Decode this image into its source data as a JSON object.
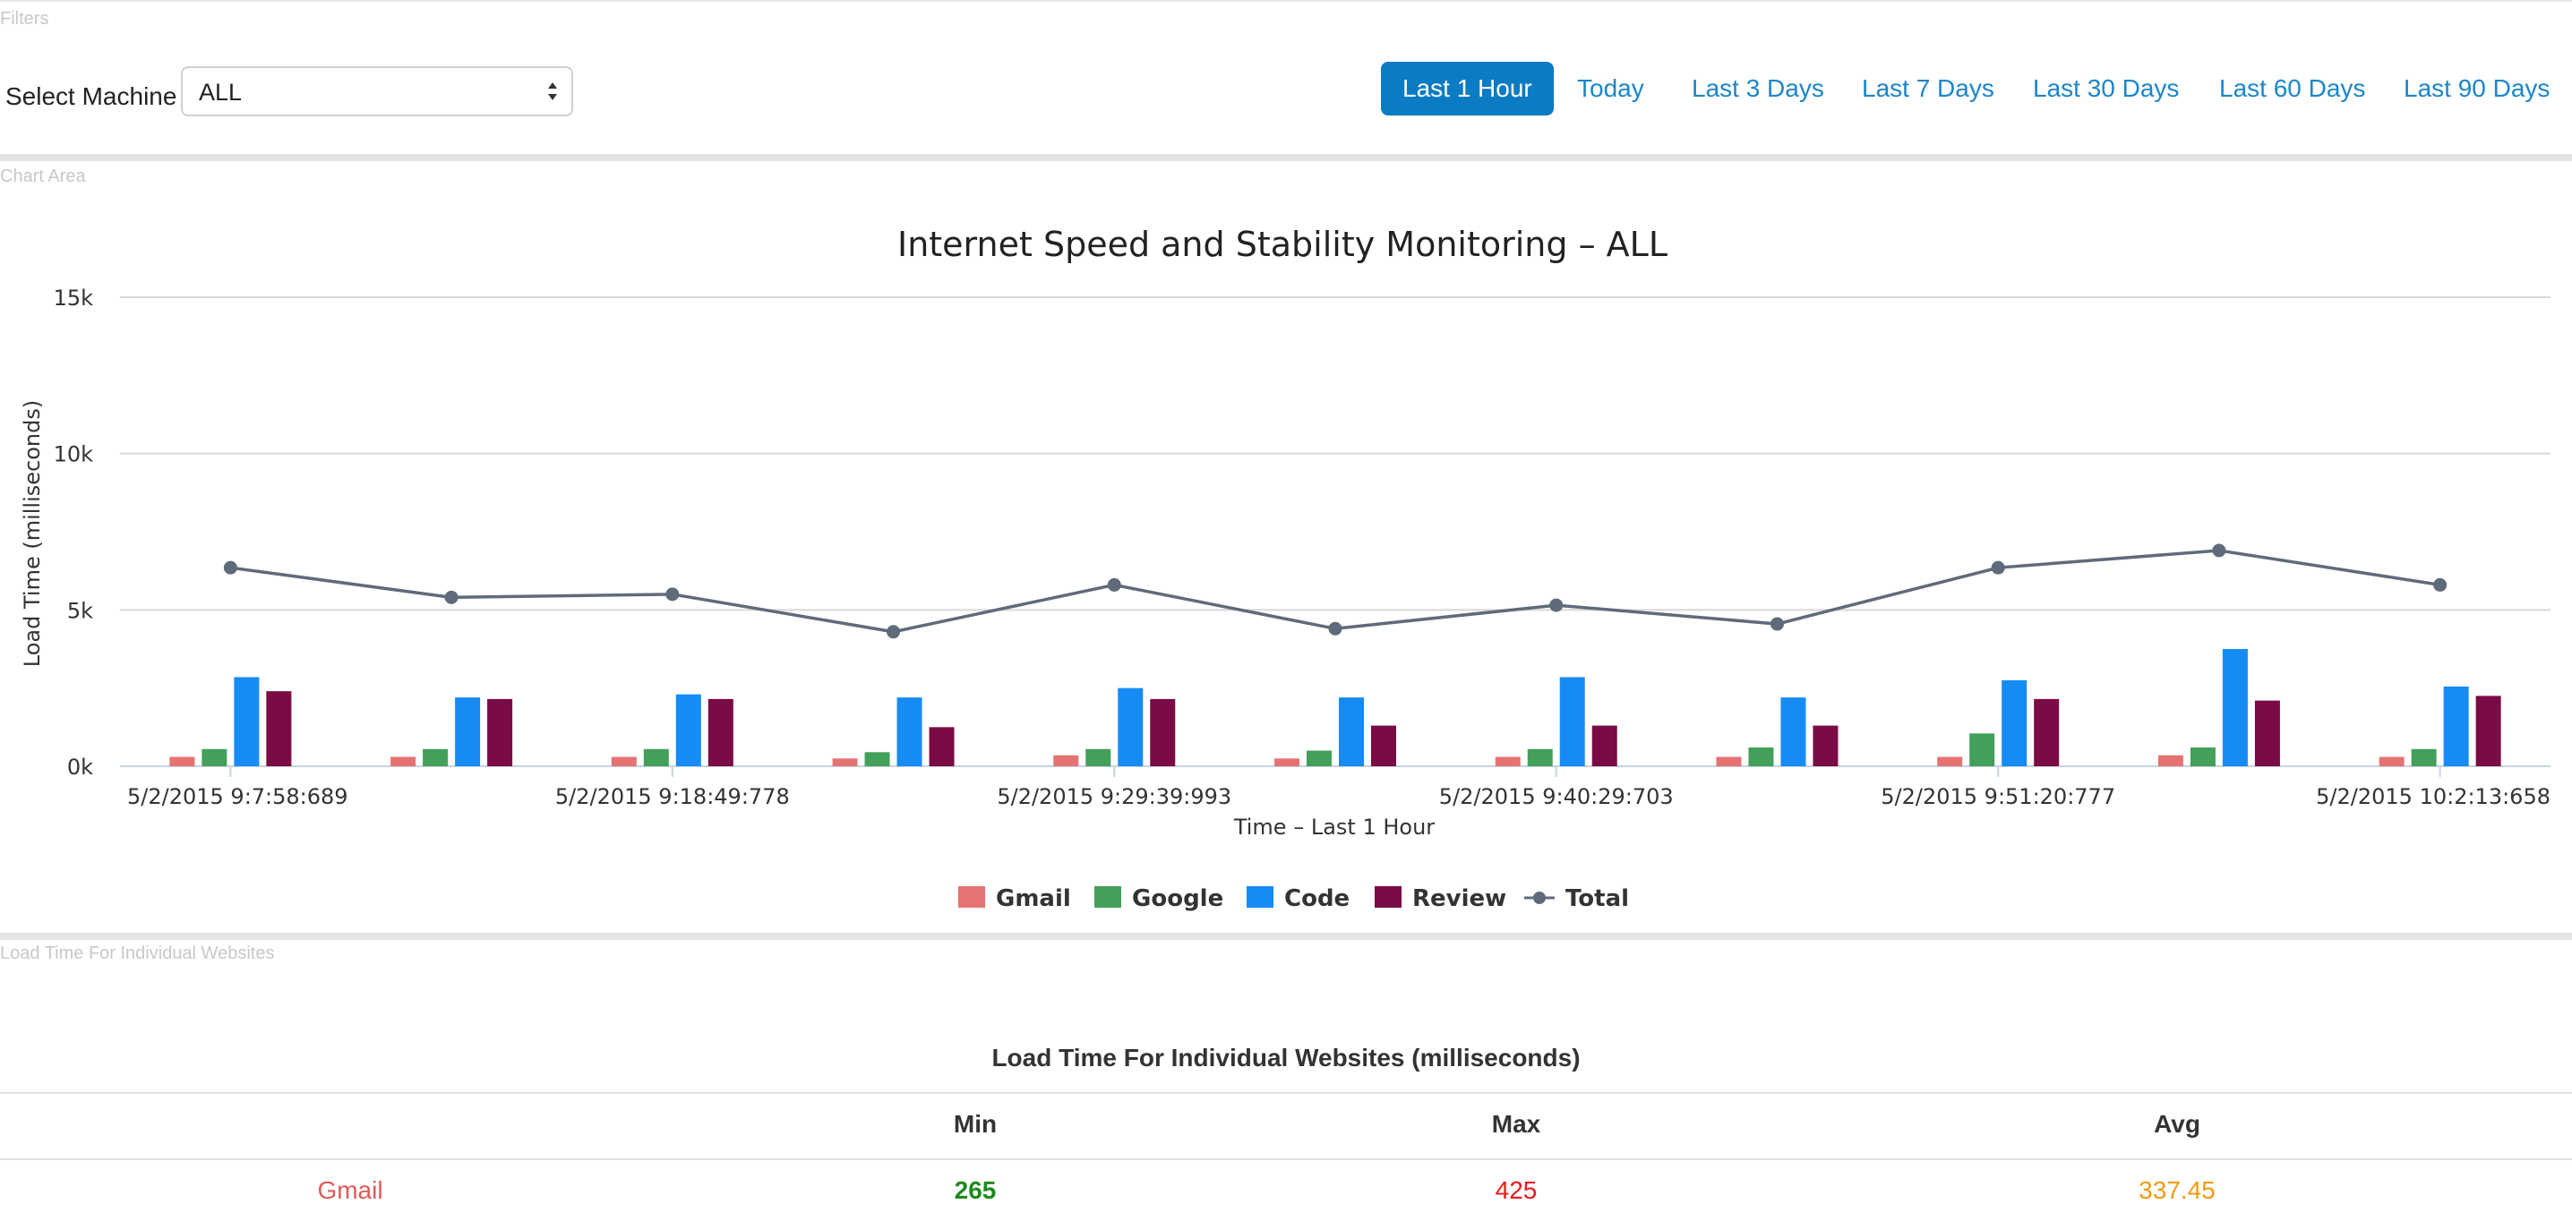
{
  "filters": {
    "section_label": "Filters",
    "machine_label": "Select Machine",
    "machine_value": "ALL",
    "ranges": [
      {
        "label": "Last 1 Hour",
        "active": true
      },
      {
        "label": "Today",
        "active": false
      },
      {
        "label": "Last 3 Days",
        "active": false
      },
      {
        "label": "Last 7 Days",
        "active": false
      },
      {
        "label": "Last 30 Days",
        "active": false
      },
      {
        "label": "Last 60 Days",
        "active": false
      },
      {
        "label": "Last 90 Days",
        "active": false
      }
    ]
  },
  "chart_section_label": "Chart Area",
  "chart_data": {
    "type": "bar",
    "title": "Internet Speed and Stability Monitoring – ALL",
    "xlabel": "Time – Last 1 Hour",
    "ylabel": "Load Time (milliseconds)",
    "ylim": [
      0,
      15000
    ],
    "yticks": [
      0,
      5000,
      10000,
      15000
    ],
    "ytick_labels": [
      "0k",
      "5k",
      "10k",
      "15k"
    ],
    "grid": true,
    "legend_position": "bottom",
    "x_tick_labels": [
      {
        "index": 0,
        "label": "5/2/2015 9:7:58:689"
      },
      {
        "index": 2,
        "label": "5/2/2015 9:18:49:778"
      },
      {
        "index": 4,
        "label": "5/2/2015 9:29:39:993"
      },
      {
        "index": 6,
        "label": "5/2/2015 9:40:29:703"
      },
      {
        "index": 8,
        "label": "5/2/2015 9:51:20:777"
      },
      {
        "index": 10,
        "label": "5/2/2015 10:2:13:658"
      }
    ],
    "category_count": 11,
    "series": [
      {
        "name": "Gmail",
        "kind": "bar",
        "color": "#e57373",
        "values": [
          300,
          300,
          300,
          250,
          350,
          250,
          300,
          300,
          300,
          350,
          300
        ]
      },
      {
        "name": "Google",
        "kind": "bar",
        "color": "#43a05a",
        "values": [
          550,
          550,
          550,
          450,
          550,
          500,
          550,
          600,
          1050,
          600,
          550
        ]
      },
      {
        "name": "Code",
        "kind": "bar",
        "color": "#168bf5",
        "values": [
          2850,
          2200,
          2300,
          2200,
          2500,
          2200,
          2850,
          2200,
          2750,
          3750,
          2550
        ]
      },
      {
        "name": "Review",
        "kind": "bar",
        "color": "#7a0b44",
        "values": [
          2400,
          2150,
          2150,
          1250,
          2150,
          1300,
          1300,
          1300,
          2150,
          2100,
          2250
        ]
      },
      {
        "name": "Total",
        "kind": "line",
        "color": "#5f6b7a",
        "values": [
          6350,
          5400,
          5500,
          4300,
          5800,
          4400,
          5150,
          4550,
          6350,
          6900,
          5800
        ]
      }
    ]
  },
  "table": {
    "section_label": "Load Time For Individual Websites",
    "title": "Load Time For Individual Websites (milliseconds)",
    "headers": [
      "",
      "Min",
      "Max",
      "Avg"
    ],
    "rows": [
      {
        "name": "Gmail",
        "min": "265",
        "max": "425",
        "avg": "337.45"
      }
    ],
    "colors": {
      "name": "#e05a5a",
      "min": "#1e8a1e",
      "max": "#e81b1b",
      "avg": "#f29a12"
    }
  }
}
